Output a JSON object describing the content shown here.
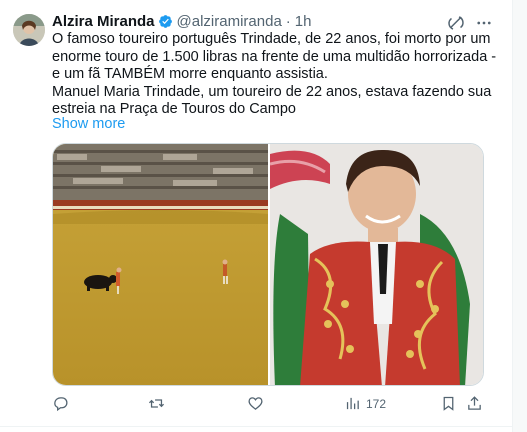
{
  "author": {
    "name": "Alzira Miranda",
    "handle": "@alziramiranda",
    "separator": "·",
    "time": "1h"
  },
  "tweet": {
    "paragraph1": "O famoso toureiro português Trindade, de 22 anos, foi morto por um enorme touro de 1.500 libras na frente de uma multidão horrorizada - e um fã TAMBÉM morre enquanto assistia.",
    "paragraph2": "Manuel Maria Trindade, um toureiro de 22 anos, estava fazendo sua estreia na Praça de Touros do Campo",
    "show_more": "Show more"
  },
  "media": {
    "image1": "bullring-with-bull-and-matador",
    "image2": "young-matador-portrait"
  },
  "actions": {
    "reply_count": "",
    "retweet_count": "",
    "like_count": "",
    "views_count": "172"
  },
  "colors": {
    "accent": "#1d9bf0",
    "text_primary": "#0f1419",
    "text_secondary": "#536471"
  }
}
